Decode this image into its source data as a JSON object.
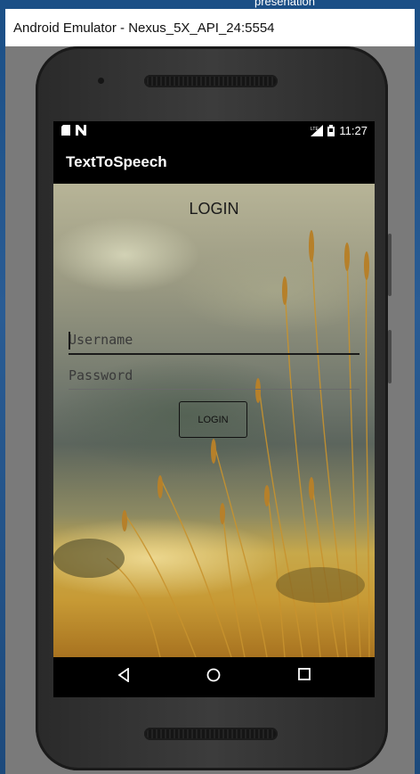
{
  "desktop": {
    "background_label": "presenation"
  },
  "window": {
    "title": "Android Emulator - Nexus_5X_API_24:5554"
  },
  "statusbar": {
    "time": "11:27",
    "left_icons": [
      "sd-card-icon",
      "n-notification-icon"
    ],
    "right_icons": [
      "lte-signal-icon",
      "battery-icon"
    ]
  },
  "appbar": {
    "title": "TextToSpeech"
  },
  "login": {
    "heading": "LOGIN",
    "username_placeholder": "Username",
    "password_placeholder": "Password",
    "button_label": "LOGIN"
  },
  "navbar": {
    "buttons": [
      "back-icon",
      "home-icon",
      "recents-icon"
    ]
  }
}
